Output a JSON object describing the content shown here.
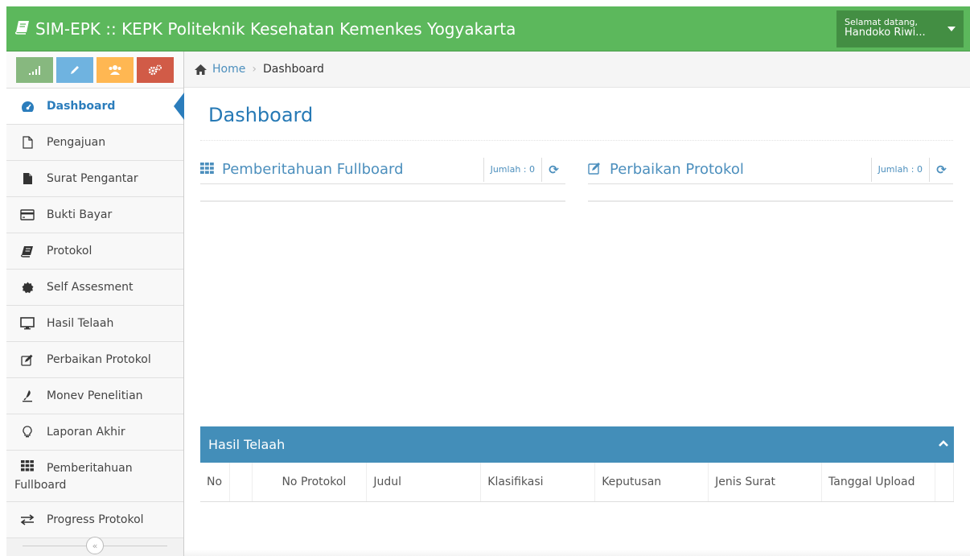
{
  "navbar": {
    "title": "SIM-EPK :: KEPK Politeknik Kesehatan Kemenkes Yogyakarta",
    "greeting": "Selamat datang,",
    "user_name": "Handoko Riwi...",
    "color": "#5cb85c"
  },
  "shortcuts": [
    {
      "icon": "signal-icon",
      "color": "#87b87f"
    },
    {
      "icon": "pencil-icon",
      "color": "#6fb3e0"
    },
    {
      "icon": "users-icon",
      "color": "#ffb752"
    },
    {
      "icon": "cogs-icon",
      "color": "#d15b47"
    }
  ],
  "sidebar": {
    "items": [
      {
        "label": "Dashboard"
      },
      {
        "label": "Pengajuan"
      },
      {
        "label": "Surat Pengantar"
      },
      {
        "label": "Bukti Bayar"
      },
      {
        "label": "Protokol"
      },
      {
        "label": "Self Assesment"
      },
      {
        "label": "Hasil Telaah"
      },
      {
        "label": "Perbaikan Protokol"
      },
      {
        "label": "Monev Penelitian"
      },
      {
        "label": "Laporan Akhir"
      },
      {
        "label": "Pemberitahuan Fullboard"
      },
      {
        "label": "Progress Protokol"
      }
    ],
    "collapse": "«"
  },
  "breadcrumb": {
    "home": "Home",
    "current": "Dashboard"
  },
  "page": {
    "title": "Dashboard"
  },
  "widgets": {
    "fullboard": {
      "title": "Pemberitahuan Fullboard",
      "count": "Jumlah : 0"
    },
    "perbaikan": {
      "title": "Perbaikan Protokol",
      "count": "Jumlah : 0"
    }
  },
  "hasil_telaah": {
    "title": "Hasil Telaah",
    "columns": [
      "No",
      "",
      "No Protokol",
      "Judul",
      "Klasifikasi",
      "Keputusan",
      "Jenis Surat",
      "Tanggal Upload",
      ""
    ]
  }
}
